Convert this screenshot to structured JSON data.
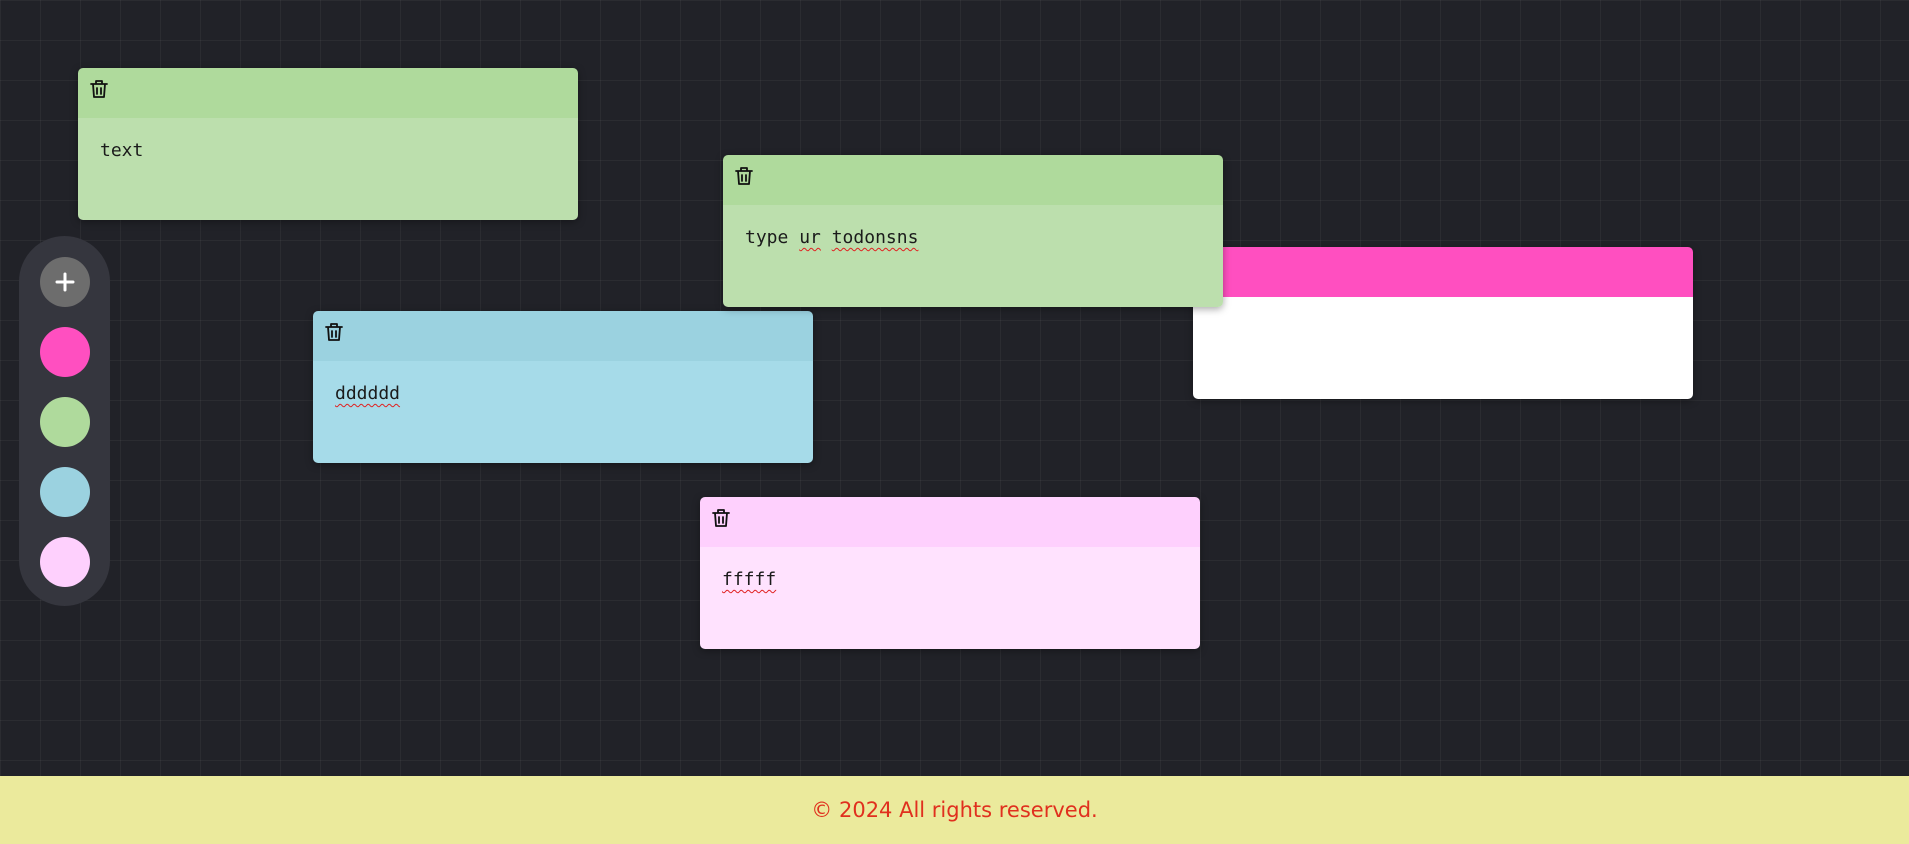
{
  "controls": {
    "add_label": "+",
    "colors": [
      {
        "name": "pink",
        "color": "#ff4fc0"
      },
      {
        "name": "green",
        "color": "#afda9c"
      },
      {
        "name": "blue",
        "color": "#9bd2e0"
      },
      {
        "name": "lavender",
        "color": "#fed0fd"
      }
    ]
  },
  "notes": [
    {
      "text": "text",
      "header_color": "#afda9c",
      "body_color": "#bcdfad"
    },
    {
      "text_parts": [
        "type ",
        "ur",
        " ",
        "todonsns"
      ],
      "header_color": "#afda9c",
      "body_color": "#bcdfad"
    },
    {
      "text": "",
      "header_color": "#ff4fc0",
      "body_color": "#ffffff"
    },
    {
      "text": "dddddd",
      "header_color": "#9bd2e0",
      "body_color": "#a6dbe9"
    },
    {
      "text": "fffff",
      "header_color": "#fed0fd",
      "body_color": "#ffe2fe"
    }
  ],
  "footer": {
    "text": "© 2024 All rights reserved."
  }
}
